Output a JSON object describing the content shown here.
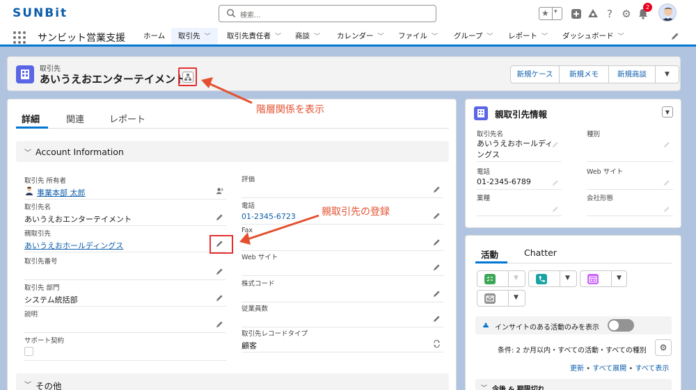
{
  "header": {
    "logo": "SUNBit",
    "search_placeholder": "検索...",
    "notification_count": "2"
  },
  "nav": {
    "app_name": "サンビット営業支援",
    "items": [
      {
        "label": "ホーム",
        "chevron": false
      },
      {
        "label": "取引先",
        "chevron": true,
        "active": true
      },
      {
        "label": "取引先責任者",
        "chevron": true
      },
      {
        "label": "商談",
        "chevron": true
      },
      {
        "label": "カレンダー",
        "chevron": true
      },
      {
        "label": "ファイル",
        "chevron": true
      },
      {
        "label": "グループ",
        "chevron": true
      },
      {
        "label": "レポート",
        "chevron": true
      },
      {
        "label": "ダッシュボード",
        "chevron": true
      }
    ]
  },
  "record": {
    "type": "取引先",
    "name": "あいうえおエンターテイメント",
    "actions": [
      "新規ケース",
      "新規メモ",
      "新規商談"
    ]
  },
  "detail_tabs": [
    "詳細",
    "関連",
    "レポート"
  ],
  "section_account": "Account Information",
  "section_other": "その他",
  "left_fields": [
    {
      "label": "取引先 所有者",
      "value": "事業本部 太郎",
      "link": true
    },
    {
      "label": "取引先名",
      "value": "あいうえおエンターテイメント",
      "link": false
    },
    {
      "label": "親取引先",
      "value": "あいうえおホールディングス",
      "link": true
    },
    {
      "label": "取引先番号",
      "value": "",
      "link": false
    },
    {
      "label": "取引先 部門",
      "value": "システム統括部",
      "link": false
    },
    {
      "label": "説明",
      "value": "",
      "link": false
    },
    {
      "label": "サポート契約",
      "value": "",
      "link": false
    }
  ],
  "right_fields": [
    {
      "label": "評価",
      "value": "",
      "link": false
    },
    {
      "label": "電話",
      "value": "01-2345-6723",
      "link": true
    },
    {
      "label": "Fax",
      "value": "",
      "link": false
    },
    {
      "label": "Web サイト",
      "value": "",
      "link": false
    },
    {
      "label": "株式コード",
      "value": "",
      "link": false
    },
    {
      "label": "従業員数",
      "value": "",
      "link": false
    },
    {
      "label": "取引先レコードタイプ",
      "value": "顧客",
      "link": false
    }
  ],
  "annotations": {
    "hierarchy": "階層関係を表示",
    "parent": "親取引先の登録"
  },
  "parent_card": {
    "title": "親取引先情報",
    "fields": [
      {
        "label": "取引先名",
        "value": "あいうえおホールディングス"
      },
      {
        "label": "種別",
        "value": ""
      },
      {
        "label": "電話",
        "value": "01-2345-6789"
      },
      {
        "label": "Web サイト",
        "value": ""
      },
      {
        "label": "業種",
        "value": ""
      },
      {
        "label": "会社形態",
        "value": ""
      }
    ]
  },
  "activity": {
    "tabs": [
      "活動",
      "Chatter"
    ],
    "insight_label": "インサイトのある活動のみを表示",
    "filter_text": "条件: 2 か月以内・すべての活動・すべての種別",
    "links": [
      "更新",
      "すべて展開",
      "すべて表示"
    ],
    "upcoming": "今後 & 期限切れ"
  },
  "colors": {
    "brand_blue": "#0176d3",
    "link_blue": "#0b5cab",
    "annotation_red": "#e42f2f",
    "account_icon": "#5a66e5"
  }
}
